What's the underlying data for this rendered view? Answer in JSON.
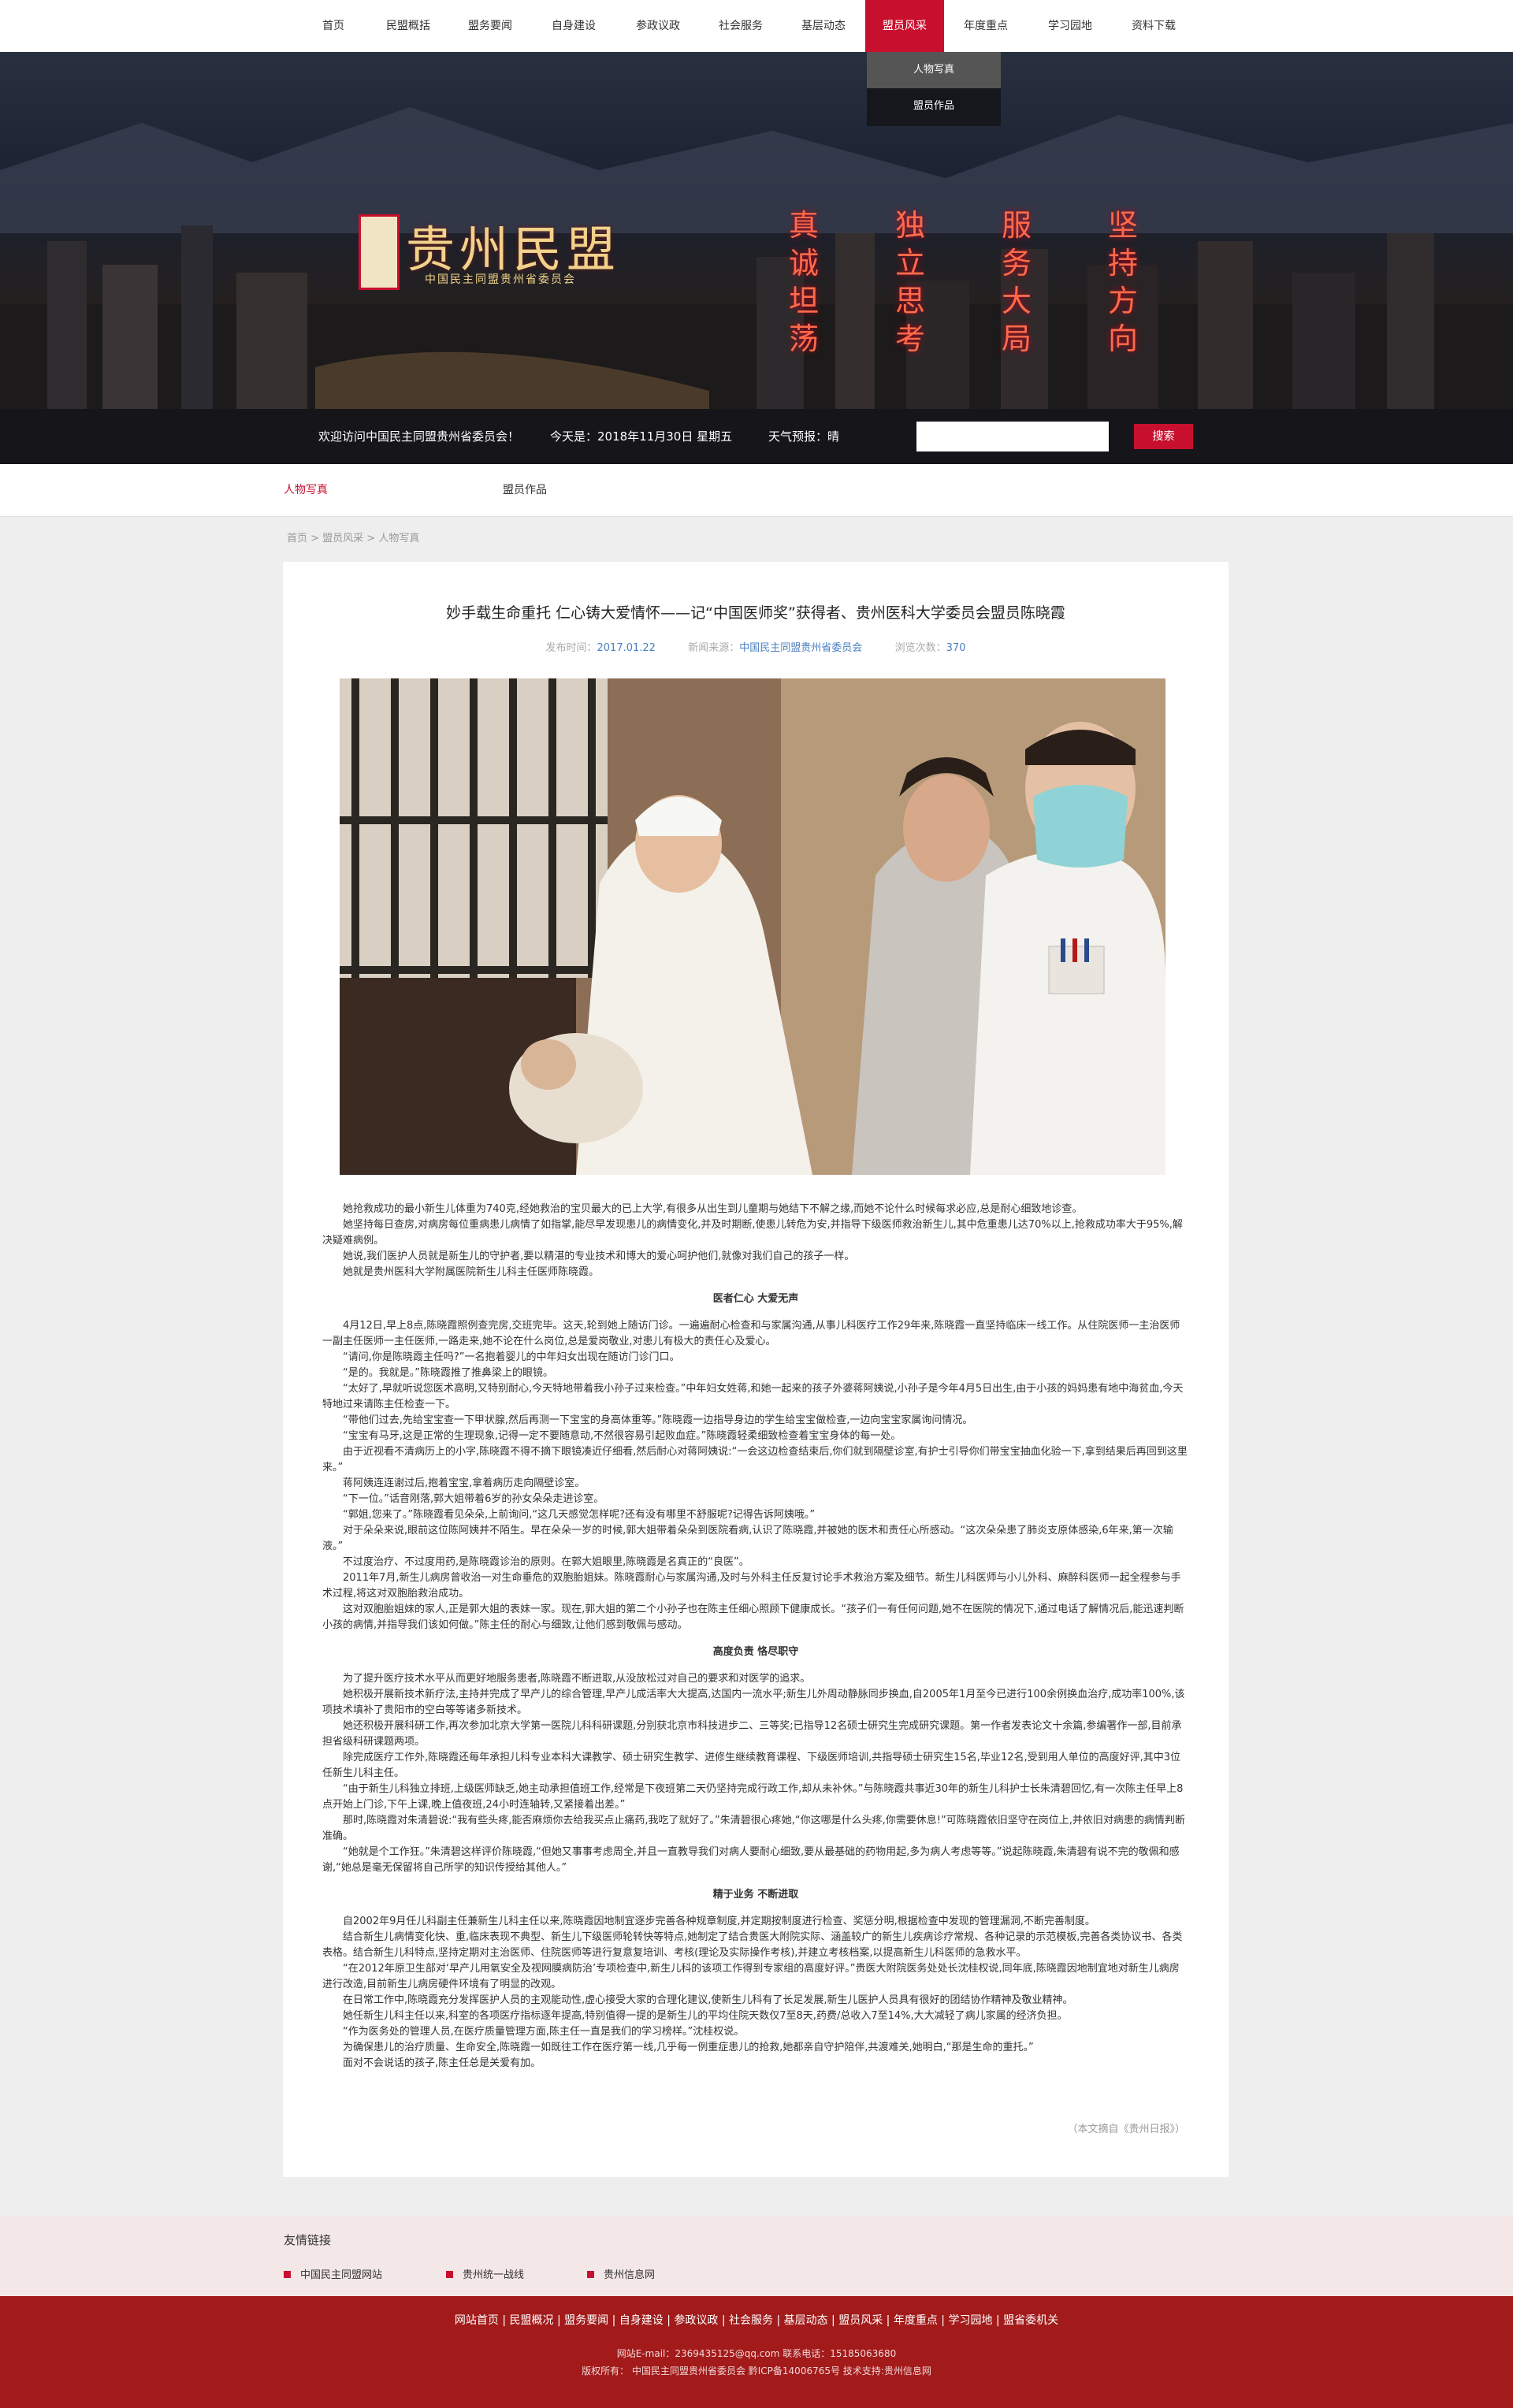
{
  "nav": {
    "items": [
      "首页",
      "民盟概括",
      "盟务要闻",
      "自身建设",
      "参政议政",
      "社会服务",
      "基层动态",
      "盟员风采",
      "年度重点",
      "学习园地",
      "资料下载"
    ],
    "active": "盟员风采",
    "dropdown": [
      "人物写真",
      "盟员作品"
    ]
  },
  "banner": {
    "logo_title": "贵州民盟",
    "logo_sub": "中国民主同盟贵州省委员会",
    "slogans": [
      "真诚坦荡",
      "独立思考",
      "服务大局",
      "坚持方向"
    ]
  },
  "infobar": {
    "welcome": "欢迎访问中国民主同盟贵州省委员会！",
    "today": "今天是：2018年11月30日  星期五",
    "weather": "天气预报：晴",
    "search_placeholder": "",
    "search_button": "搜索"
  },
  "subnav": {
    "items": [
      "人物写真",
      "盟员作品"
    ],
    "active": "人物写真"
  },
  "breadcrumb": "首页 > 盟员风采 > 人物写真",
  "article": {
    "title": "妙手载生命重托 仁心铸大爱情怀——记“中国医师奖”获得者、贵州医科大学委员会盟员陈晓霞",
    "meta": {
      "date_label": "发布时间：",
      "date": "2017.01.22",
      "source_label": "新闻来源：",
      "source": "中国民主同盟贵州省委员会",
      "views_label": "浏览次数：",
      "views": "370"
    },
    "intro": [
      "她抢救成功的最小新生儿体重为740克,经她救治的宝贝最大的已上大学,有很多从出生到儿童期与她结下不解之缘,而她不论什么时候每求必应,总是耐心细致地诊查。",
      "她坚持每日查房,对病房每位重病患儿病情了如指掌,能尽早发现患儿的病情变化,并及时期断,使患儿转危为安,并指导下级医师救治新生儿,其中危重患儿达70%以上,抢救成功率大于95%,解决疑难病例。",
      "她说,我们医护人员就是新生儿的守护者,要以精湛的专业技术和博大的爱心呵护他们,就像对我们自己的孩子一样。",
      "她就是贵州医科大学附属医院新生儿科主任医师陈晓霞。"
    ],
    "section1_title": "医者仁心 大爱无声",
    "section1": [
      "4月12日,早上8点,陈晓霞照例查完房,交班完毕。这天,轮到她上随访门诊。一遍遍耐心检查和与家属沟通,从事儿科医疗工作29年来,陈晓霞一直坚持临床一线工作。从住院医师一主治医师一副主任医师一主任医师,一路走来,她不论在什么岗位,总是爱岗敬业,对患儿有极大的责任心及爱心。",
      "“请问,你是陈晓霞主任吗?”一名抱着婴儿的中年妇女出现在随访门诊门口。",
      "“是的。我就是。”陈晓霞推了推鼻梁上的眼镜。",
      "“太好了,早就听说您医术高明,又特别耐心,今天特地带着我小孙子过来检查。”中年妇女姓蒋,和她一起来的孩子外婆蒋阿姨说,小孙子是今年4月5日出生,由于小孩的妈妈患有地中海贫血,今天特地过来请陈主任检查一下。",
      "“带他们过去,先给宝宝查一下甲状腺,然后再测一下宝宝的身高体重等。”陈晓霞一边指导身边的学生给宝宝做检查,一边向宝宝家属询问情况。",
      "“宝宝有马牙,这是正常的生理现象,记得一定不要随意动,不然很容易引起败血症。”陈晓霞轻柔细致检查着宝宝身体的每一处。",
      "由于近视看不清病历上的小字,陈晓霞不得不摘下眼镜凑近仔细看,然后耐心对蒋阿姨说:“一会这边检查结束后,你们就到隔壁诊室,有护士引导你们带宝宝抽血化验一下,拿到结果后再回到这里来。”",
      "蒋阿姨连连谢过后,抱着宝宝,拿着病历走向隔壁诊室。",
      "“下一位。”话音刚落,郭大姐带着6岁的孙女朵朵走进诊室。",
      "“郭姐,您来了。”陈晓霞看见朵朵,上前询问,“这几天感觉怎样呢?还有没有哪里不舒服呢?记得告诉阿姨哦。”",
      "对于朵朵来说,眼前这位陈阿姨并不陌生。早在朵朵一岁的时候,郭大姐带着朵朵到医院看病,认识了陈晓霞,并被她的医术和责任心所感动。“这次朵朵患了肺炎支原体感染,6年来,第一次输液。”",
      "不过度治疗、不过度用药,是陈晓霞诊治的原则。在郭大姐眼里,陈晓霞是名真正的“良医”。",
      "2011年7月,新生儿病房曾收治一对生命垂危的双胞胎姐妹。陈晓霞耐心与家属沟通,及时与外科主任反复讨论手术救治方案及细节。新生儿科医师与小儿外科、麻醉科医师一起全程参与手术过程,将这对双胞胎救治成功。",
      "这对双胞胎姐妹的家人,正是郭大姐的表妹一家。现在,郭大姐的第二个小孙子也在陈主任细心照顾下健康成长。“孩子们一有任何问题,她不在医院的情况下,通过电话了解情况后,能迅速判断小孩的病情,并指导我们该如何做。”陈主任的耐心与细致,让他们感到敬佩与感动。"
    ],
    "section2_title": "高度负责 恪尽职守",
    "section2": [
      "为了提升医疗技术水平从而更好地服务患者,陈晓霞不断进取,从没放松过对自己的要求和对医学的追求。",
      "她积极开展新技术新疗法,主持并完成了早产儿的综合管理,早产儿成活率大大提高,达国内一流水平;新生儿外周动静脉同步换血,自2005年1月至今已进行100余例换血治疗,成功率100%,该项技术填补了贵阳市的空白等等诸多新技术。",
      "她还积极开展科研工作,再次参加北京大学第一医院儿科科研课题,分别获北京市科技进步二、三等奖;已指导12名硕士研究生完成研究课题。第一作者发表论文十余篇,参编著作一部,目前承担省级科研课题两项。",
      "除完成医疗工作外,陈晓霞还每年承担儿科专业本科大课教学、硕士研究生教学、进修生继续教育课程、下级医师培训,共指导硕士研究生15名,毕业12名,受到用人单位的高度好评,其中3位任新生儿科主任。",
      "“由于新生儿科独立排班,上级医师缺乏,她主动承担值班工作,经常是下夜班第二天仍坚持完成行政工作,却从未补休。”与陈晓霞共事近30年的新生儿科护士长朱清碧回忆,有一次陈主任早上8点开始上门诊,下午上课,晚上值夜班,24小时连轴转,又紧接着出差。”",
      "那时,陈晓霞对朱清碧说:“我有些头疼,能否麻烦你去给我买点止痛药,我吃了就好了。”朱清碧很心疼她,“你这哪是什么头疼,你需要休息!”可陈晓霞依旧坚守在岗位上,并依旧对病患的病情判断准确。",
      "“她就是个工作狂。”朱清碧这样评价陈晓霞,“但她又事事考虑周全,并且一直教导我们对病人要耐心细致,要从最基础的药物用起,多为病人考虑等等。”说起陈晓霞,朱清碧有说不完的敬佩和感谢,“她总是毫无保留将自己所学的知识传授给其他人。”"
    ],
    "section3_title": "精于业务 不断进取",
    "section3": [
      "自2002年9月任儿科副主任兼新生儿科主任以来,陈晓霞因地制宜逐步完善各种规章制度,并定期按制度进行检查、奖惩分明,根据检查中发现的管理漏洞,不断完善制度。",
      "结合新生儿病情变化快、重,临床表现不典型、新生儿下级医师轮转快等特点,她制定了结合贵医大附院实际、涵盖较广的新生儿疾病诊疗常规、各种记录的示范模板,完善各类协议书、各类表格。结合新生儿科特点,坚持定期对主治医师、住院医师等进行复意复培训、考核(理论及实际操作考核),并建立考核档案,以提高新生儿科医师的急救水平。",
      "“在2012年原卫生部对‘早产儿用氧安全及视网膜病防治’专项检查中,新生儿科的该项工作得到专家组的高度好评。”贵医大附院医务处处长沈桂权说,同年底,陈晓霞因地制宜地对新生儿病房进行改造,目前新生儿病房硬件环境有了明显的改观。",
      "在日常工作中,陈晓霞充分发挥医护人员的主观能动性,虚心接受大家的合理化建议,使新生儿科有了长足发展,新生儿医护人员具有很好的团结协作精神及敬业精神。",
      "她任新生儿科主任以来,科室的各项医疗指标逐年提高,特别值得一提的是新生儿的平均住院天数仅7至8天,药费/总收入7至14%,大大减轻了病儿家属的经济负担。",
      "“作为医务处的管理人员,在医疗质量管理方面,陈主任一直是我们的学习榜样。”沈桂权说。",
      "为确保患儿的治疗质量、生命安全,陈晓霞一如既往工作在医疗第一线,几乎每一例重症患儿的抢救,她都亲自守护陪伴,共渡难关,她明白,“那是生命的重托。”",
      "面对不会说话的孩子,陈主任总是关爱有加。"
    ],
    "source_note": "（本文摘自《贵州日报》）"
  },
  "links": {
    "title": "友情链接",
    "items": [
      "中国民主同盟网站",
      "贵州统一战线",
      "贵州信息网"
    ]
  },
  "footer": {
    "nav": "网站首页 | 民盟概况 | 盟务要闻 | 自身建设 | 参政议政 | 社会服务 | 基层动态 | 盟员风采 | 年度重点 | 学习园地 | 盟省委机关",
    "line1": "网站E-mail：2369435125@qq.com 联系电话：15185063680",
    "line2": "版权所有：   中国民主同盟贵州省委员会  黔ICP备14006765号  技术支持:贵州信息网"
  },
  "colors": {
    "accent": "#c8102e",
    "footer_bg": "#a21a1a",
    "link_blue": "#4a7fc1"
  }
}
